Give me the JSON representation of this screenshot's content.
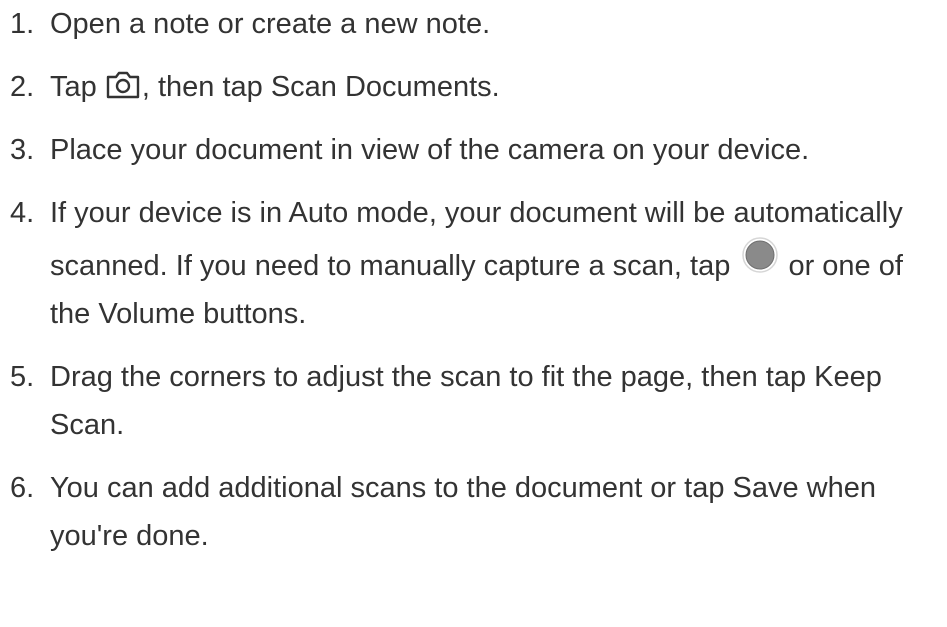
{
  "steps": [
    {
      "number": "1.",
      "text": "Open a note or create a new note."
    },
    {
      "number": "2.",
      "before": "Tap ",
      "icon": "camera-icon",
      "after": ", then tap Scan Documents."
    },
    {
      "number": "3.",
      "text": "Place your document in view of the camera on your device."
    },
    {
      "number": "4.",
      "before": "If your device is in Auto mode, your document will be automatically scanned. If you need to manually capture a scan, tap ",
      "icon": "shutter-button-icon",
      "after": " or one of the Volume buttons."
    },
    {
      "number": "5.",
      "text": "Drag the corners to adjust the scan to fit the page, then tap Keep Scan."
    },
    {
      "number": "6.",
      "text": "You can add additional scans to the document or tap Save when you're done."
    }
  ],
  "colors": {
    "text": "#333333",
    "shutter_fill": "#8a8a8a",
    "background": "#ffffff"
  }
}
